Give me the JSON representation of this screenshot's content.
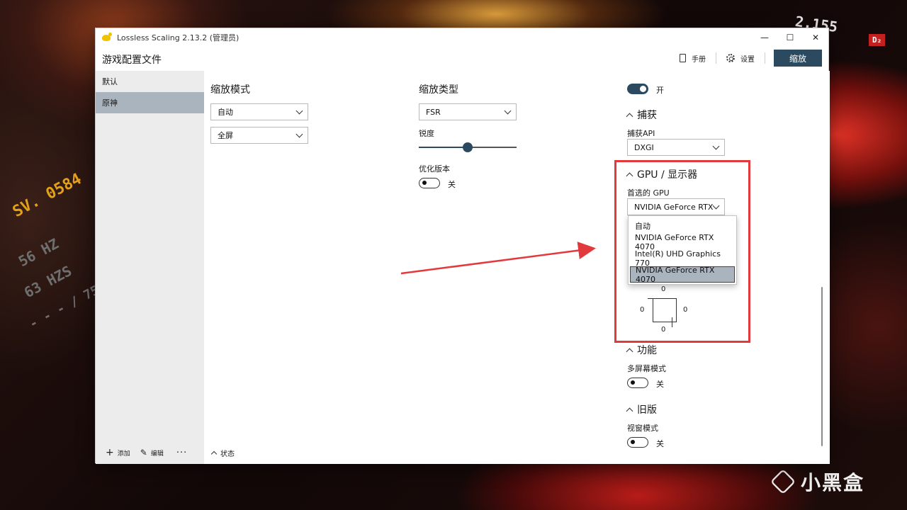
{
  "app": {
    "title": "Lossless Scaling 2.13.2 (管理员)"
  },
  "window_controls": {
    "minimize": "—",
    "maximize": "☐",
    "close": "✕"
  },
  "header": {
    "page_title": "游戏配置文件",
    "manual_label": "手册",
    "settings_label": "设置",
    "scale_button": "缩放"
  },
  "sidebar": {
    "items": [
      {
        "label": "默认",
        "active": false
      },
      {
        "label": "原神",
        "active": true
      }
    ],
    "add_label": "添加",
    "edit_label": "编辑",
    "more_label": "···"
  },
  "scaling_mode": {
    "title": "缩放模式",
    "mode_value": "自动",
    "window_value": "全屏"
  },
  "scaling_type": {
    "title": "缩放类型",
    "type_value": "FSR",
    "sharpness_label": "锐度",
    "sharpness_fraction": 0.5,
    "optimized_label": "优化版本",
    "optimized_state": "关"
  },
  "right_panel": {
    "master_toggle_state": "开",
    "capture": {
      "title": "捕获",
      "api_label": "捕获API",
      "api_value": "DXGI"
    },
    "gpu": {
      "title": "GPU / 显示器",
      "preferred_label": "首选的 GPU",
      "preferred_value": "NVIDIA GeForce RTX",
      "options": [
        "自动",
        "NVIDIA GeForce RTX 4070",
        "Intel(R) UHD Graphics 770",
        "NVIDIA GeForce RTX 4070"
      ],
      "selected_index": 3,
      "offsets": {
        "top": "0",
        "left": "0",
        "right": "0",
        "bottom": "0"
      }
    },
    "features": {
      "title": "功能",
      "multi_screen_label": "多屏幕模式",
      "multi_screen_state": "关"
    },
    "legacy": {
      "title": "旧版",
      "windowed_label": "视窗模式",
      "windowed_state": "关"
    }
  },
  "status": {
    "label": "状态"
  },
  "desktop": {
    "hud_1": "SV. 0584",
    "hud_2": "56 HZ",
    "hud_3": "63 HZS",
    "hud_4": "- - - / 75",
    "hud_5": "2.155",
    "hud_6": "D₂",
    "watermark": "小黑盒"
  },
  "colors": {
    "accent": "#2b4a5f",
    "selection": "#a9b4be",
    "annotation": "#e2393d"
  }
}
